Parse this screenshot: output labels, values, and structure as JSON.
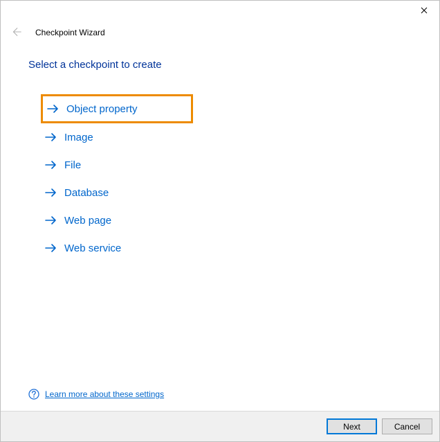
{
  "window": {
    "title": "Checkpoint Wizard"
  },
  "heading": "Select a checkpoint to create",
  "options": [
    {
      "label": "Object property",
      "selected": true
    },
    {
      "label": "Image",
      "selected": false
    },
    {
      "label": "File",
      "selected": false
    },
    {
      "label": "Database",
      "selected": false
    },
    {
      "label": "Web page",
      "selected": false
    },
    {
      "label": "Web service",
      "selected": false
    }
  ],
  "help": {
    "link_label": "Learn more about these settings"
  },
  "footer": {
    "next_label": "Next",
    "cancel_label": "Cancel"
  }
}
